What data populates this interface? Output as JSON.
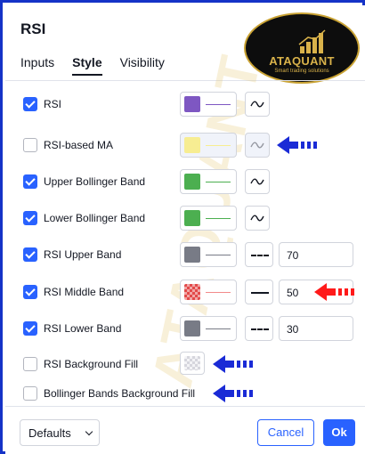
{
  "dialog": {
    "title": "RSI"
  },
  "tabs": [
    {
      "label": "Inputs",
      "active": false
    },
    {
      "label": "Style",
      "active": true
    },
    {
      "label": "Visibility",
      "active": false
    }
  ],
  "logo": {
    "name": "ATAQUANT",
    "tagline": "Smart trading solutions"
  },
  "watermark": "ATAQUANT",
  "rows": [
    {
      "label": "RSI",
      "checked": true,
      "color": "#7e57c2",
      "line_color": "#7e57c2",
      "shape_icon": "plot-line-icon"
    },
    {
      "label": "RSI-based MA",
      "checked": false,
      "color": "#f7ed92",
      "line_color": "#f7ed92",
      "shape_icon": "plot-line-icon"
    },
    {
      "label": "Upper Bollinger Band",
      "checked": true,
      "color": "#4caf50",
      "line_color": "#4caf50",
      "shape_icon": "plot-line-icon"
    },
    {
      "label": "Lower Bollinger Band",
      "checked": true,
      "color": "#4caf50",
      "line_color": "#4caf50",
      "shape_icon": "plot-line-icon"
    },
    {
      "label": "RSI Upper Band",
      "checked": true,
      "color": "#787b86",
      "line_color": "#787b86",
      "line_style": "dashed",
      "value": "70"
    },
    {
      "label": "RSI Middle Band",
      "checked": true,
      "color": "#e34a4a",
      "line_color": "#f28b8b",
      "line_style": "solid",
      "value": "50"
    },
    {
      "label": "RSI Lower Band",
      "checked": true,
      "color": "#787b86",
      "line_color": "#787b86",
      "line_style": "dashed",
      "value": "30"
    },
    {
      "label": "RSI Background Fill",
      "checked": false
    },
    {
      "label": "Bollinger Bands Background Fill",
      "checked": false
    }
  ],
  "footer": {
    "defaults_label": "Defaults",
    "cancel_label": "Cancel",
    "ok_label": "Ok"
  },
  "colors": {
    "accent": "#2962ff",
    "annotation_blue": "#1a2bd6",
    "annotation_red": "#ff1a1a"
  }
}
